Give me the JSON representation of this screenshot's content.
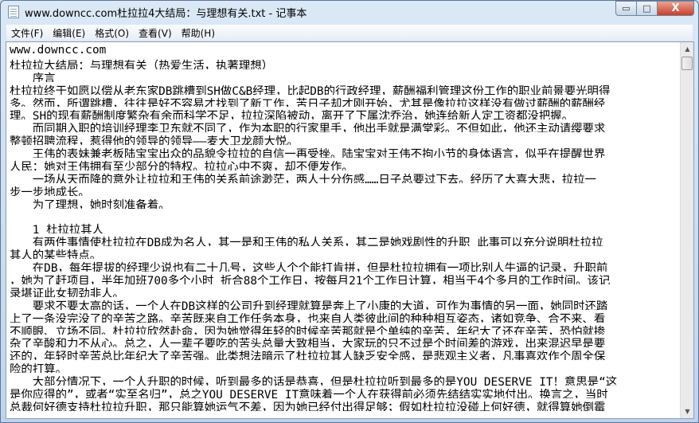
{
  "window": {
    "title": "www.downcc.com杜拉拉4大结局：与理想有关.txt - 记事本",
    "controls": {
      "minimize": "▭",
      "maximize": "□",
      "close": "X"
    }
  },
  "menu": [
    "文件(F)",
    "编辑(E)",
    "格式(O)",
    "查看(V)",
    "帮助(H)"
  ],
  "scrollbar": {
    "up": "▲",
    "down": "▼",
    "position": 0.0
  },
  "lines": [
    "www.downcc.com",
    "杜拉拉大结局：与理想有关（热爱生活，执著理想）",
    "　　序言",
    "杜拉拉终于如愿以偿从老东家DB跳槽到SH做C&B经理，比起DB的行政经理，薪酬福利管理这份工作的职业前景要光明得",
    "多。然而，所谓跳槽，往往是好不容易才找到了新工作，苦日子却才刚开始，尤其是像拉拉这样没有做过薪酬的薪酬经",
    "理。SH的现有薪酬制度繁杂有余而科学不足，拉拉深陷被动，离开了下属沈乔治，她连给新人定工资都没把握。",
    "　　而同期入职的培训经理李卫东就不同了，作为本职的行家里手，他出手就是满堂彩。不但如此，他还主动请缨要求",
    "整顿招聘流程，惹得他的领导的领导——麦大卫龙颜大悦。",
    "　　王伟的表妹兼老板陆宝宝出众的品貌令拉拉的自信一再受挫。陆宝宝对王伟不拘小节的身体语言，似乎在提醒世界",
    "人民：她对王伟拥有至少部分的特权。拉拉心中不爽，却不便发作。",
    "　　一场从天而降的意外让拉拉和王伟的关系前途渺茫，两人十分伤感……日子总要过下去。经历了大喜大悲，拉拉一",
    "步一步地成长。",
    "　　为了理想，她时刻准备着。",
    "",
    "　　1 杜拉拉其人",
    "　　有两件事情使杜拉拉在DB成为名人，其一是和王伟的私人关系，其二是她戏剧性的升职 此事可以充分说明杜拉拉",
    "其人的某些特点。",
    "　　在DB，每年提拔的经理少说也有二十几号，这些人个个能打肯拼，但是杜拉拉拥有一项比别人牛逼的记录，升职前",
    "，她为了赶项目，半年加班700多个小时 折合88个工作日，按每月21个工作日计算，相当于4个多月的工作时间。该记",
    "录堪证此女韧劲非人。",
    "　　要求不要太高的话，一个人在DB这样的公司升到经理就算是奔上了小康的大道，可作为事情的另一面，她同时还踏",
    "上了一条没完没了的辛苦之路。辛苦既来自工作任务本身，也来自人类彼此间的种种相互姿态，诸如竞争、合不来、看",
    "不顺眼、立场不同。杜拉拉欣然赴命，因为她觉得年轻的时候辛苦那就是个单纯的辛苦，年纪大了还在辛苦，恐怕就掺",
    "杂了辛酸和力不从心。总之，人一辈子要吃的苦头总量大致相当，大家玩的只不过是个时间差的游戏，出来混迟早是要",
    "还的，年轻时辛苦总比年纪大了辛苦强。此类想法暗示了杜拉拉其人缺乏安全感，是悲观主义者，凡事喜欢作个周全保",
    "险的打算。",
    "　　大部分情况下，一个人升职的时候，听到最多的话是恭喜，但是杜拉拉听到最多的是YOU DESERVE IT！意思是“这",
    "是你应得的”，或者“实至名归”，总之YOU DESERVE IT意味着一个人在获得前必须先结结实实地付出。换言之，当时",
    "总裁何好德支持杜拉拉升职，那只能算她运气不差，因为她已经付出得足够；假如杜拉拉没碰上何好德，就得算她倒霉"
  ]
}
